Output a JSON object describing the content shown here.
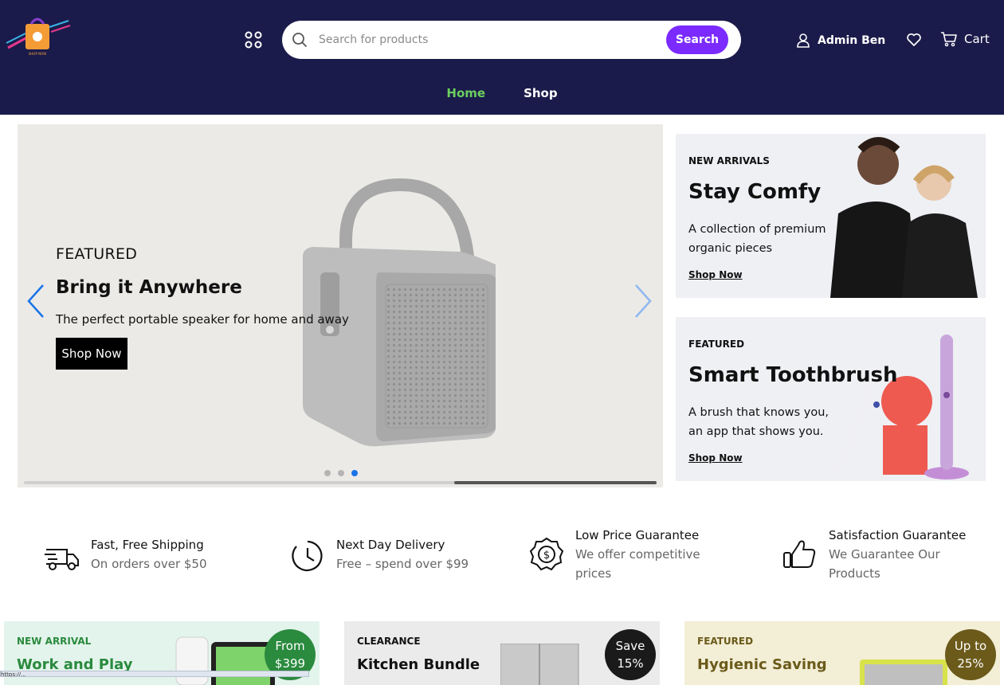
{
  "header": {
    "logo_alt": "SHOP NOW",
    "search": {
      "placeholder": "Search for products",
      "button": "Search"
    },
    "user": "Admin Ben",
    "cart": "Cart",
    "nav": [
      {
        "label": "Home",
        "active": true
      },
      {
        "label": "Shop",
        "active": false
      }
    ],
    "colors": {
      "bg": "#1b1b4b",
      "accent": "#7b2bff",
      "nav_active": "#6ccf5f"
    }
  },
  "hero": {
    "eyebrow": "FEATURED",
    "title": "Bring it Anywhere",
    "subtitle": "The perfect portable speaker for home and away",
    "button": "Shop Now",
    "slides": 3,
    "active_slide": 3,
    "progress": 0.32
  },
  "promos": [
    {
      "eyebrow": "NEW ARRIVALS",
      "title": "Stay Comfy",
      "subtitle": "A collection of premium organic pieces",
      "link": "Shop Now"
    },
    {
      "eyebrow": "FEATURED",
      "title": "Smart Toothbrush",
      "subtitle": "A brush that knows you, an app that shows you.",
      "link": "Shop Now"
    }
  ],
  "features": [
    {
      "icon": "truck-icon",
      "title": "Fast, Free Shipping",
      "subtitle": "On orders over $50"
    },
    {
      "icon": "clock-icon",
      "title": "Next Day Delivery",
      "subtitle": "Free – spend over $99"
    },
    {
      "icon": "dollar-badge-icon",
      "title": "Low Price Guarantee",
      "subtitle": "We offer competitive prices"
    },
    {
      "icon": "thumbs-up-icon",
      "title": "Satisfaction Guarantee",
      "subtitle": "We Guarantee Our Products"
    }
  ],
  "cards": [
    {
      "eyebrow": "NEW ARRIVAL",
      "title": "Work and Play",
      "badge_line1": "From",
      "badge_line2": "$399",
      "bg": "#e3f4ec",
      "color": "#2a8a3e",
      "badge_bg": "#2a8a3e"
    },
    {
      "eyebrow": "CLEARANCE",
      "title": "Kitchen Bundle",
      "badge_line1": "Save",
      "badge_line2": "15%",
      "bg": "#ebebeb",
      "color": "#111111",
      "badge_bg": "#1a1a1a"
    },
    {
      "eyebrow": "FEATURED",
      "title": "Hygienic Saving",
      "badge_line1": "Up to",
      "badge_line2": "25%",
      "bg": "#f3eed6",
      "color": "#6b5a1a",
      "badge_bg": "#6b5a1a"
    }
  ],
  "statusbar": "https://..."
}
